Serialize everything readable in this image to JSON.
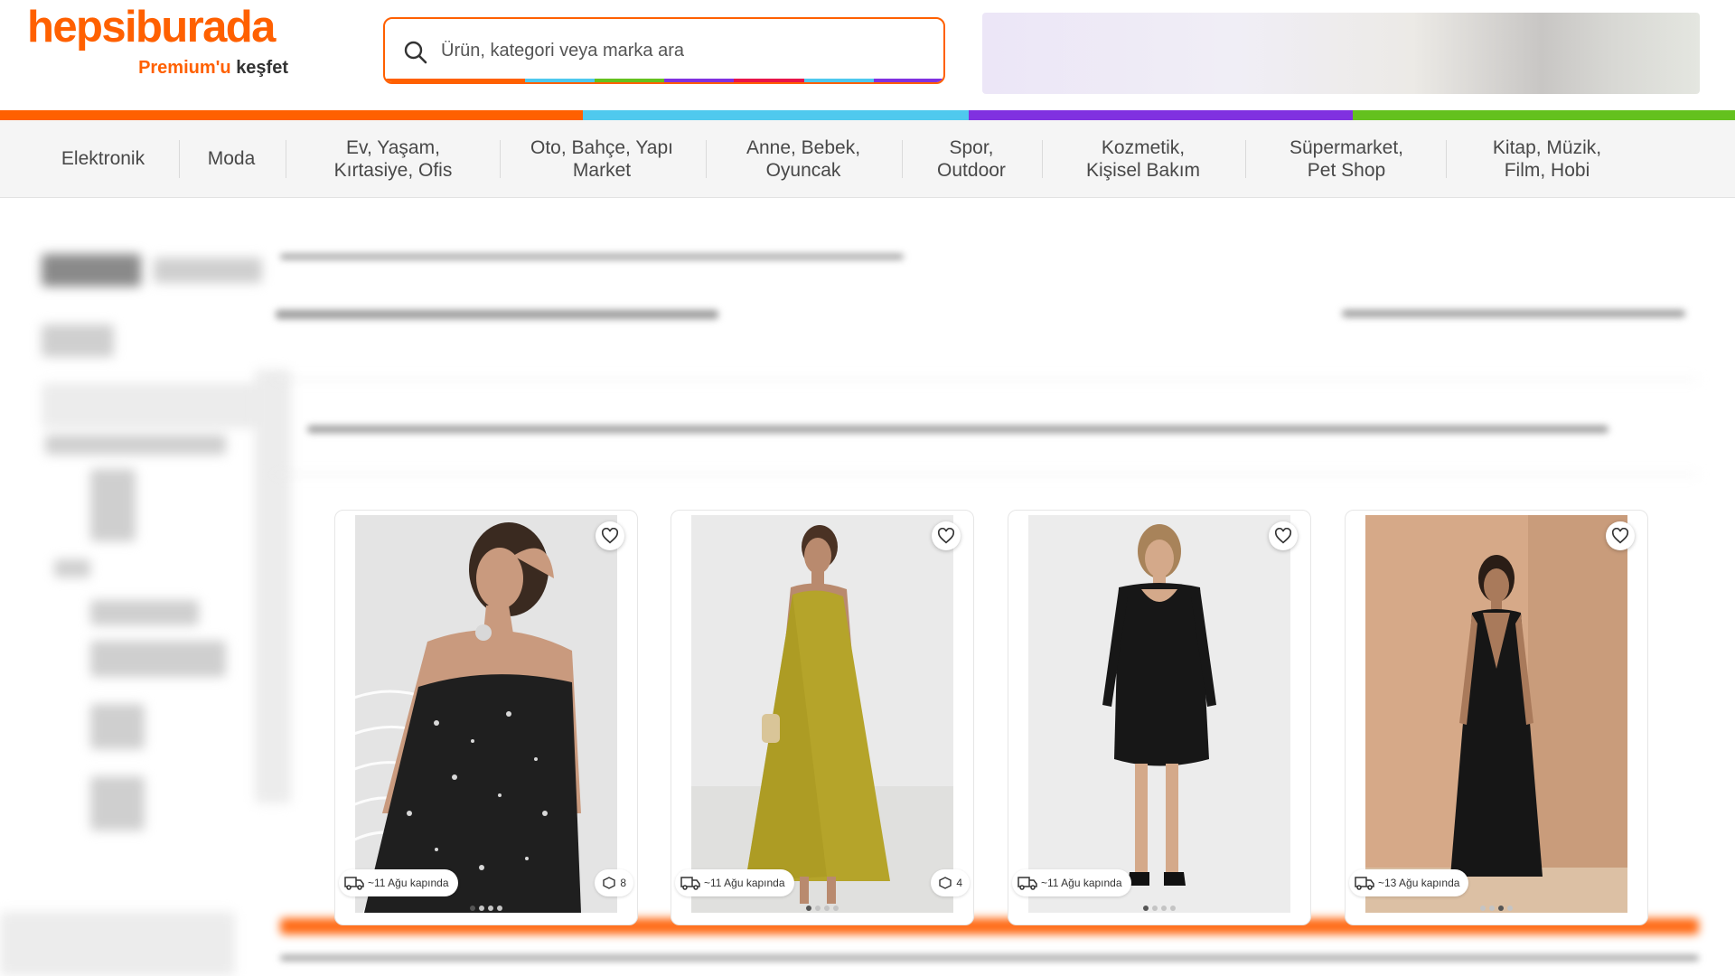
{
  "brand": {
    "logo_text": "hepsiburada",
    "premium_orange": "Premium'u",
    "premium_dark": "keşfet",
    "accent": "#ff6000"
  },
  "search": {
    "placeholder": "Ürün, kategori veya marka ara",
    "icon": "search-icon"
  },
  "color_bar": [
    "#ff6000",
    "#4fc9ee",
    "#8031e0",
    "#64c11e"
  ],
  "nav": {
    "items": [
      {
        "label": "Elektronik"
      },
      {
        "label": "Moda"
      },
      {
        "label": "Ev, Yaşam,\nKırtasiye, Ofis"
      },
      {
        "label": "Oto, Bahçe, Yapı\nMarket"
      },
      {
        "label": "Anne, Bebek,\nOyuncak"
      },
      {
        "label": "Spor,\nOutdoor"
      },
      {
        "label": "Kozmetik,\nKişisel Bakım"
      },
      {
        "label": "Süpermarket,\nPet Shop"
      },
      {
        "label": "Kitap, Müzik,\nFilm, Hobi"
      }
    ]
  },
  "products": [
    {
      "delivery": "~11 Ağu kapında",
      "variant_count": "8",
      "image": "floral-slip-dress",
      "slide_index": 1,
      "slide_total": 4
    },
    {
      "delivery": "~11 Ağu kapında",
      "variant_count": "4",
      "image": "olive-maxi-dress",
      "slide_index": 1,
      "slide_total": 4
    },
    {
      "delivery": "~11 Ağu kapında",
      "variant_count": "",
      "image": "black-knit-dress",
      "slide_index": 1,
      "slide_total": 4
    },
    {
      "delivery": "~13 Ağu kapında",
      "variant_count": "",
      "image": "black-halter-jumpsuit",
      "slide_index": 3,
      "slide_total": 4
    }
  ]
}
